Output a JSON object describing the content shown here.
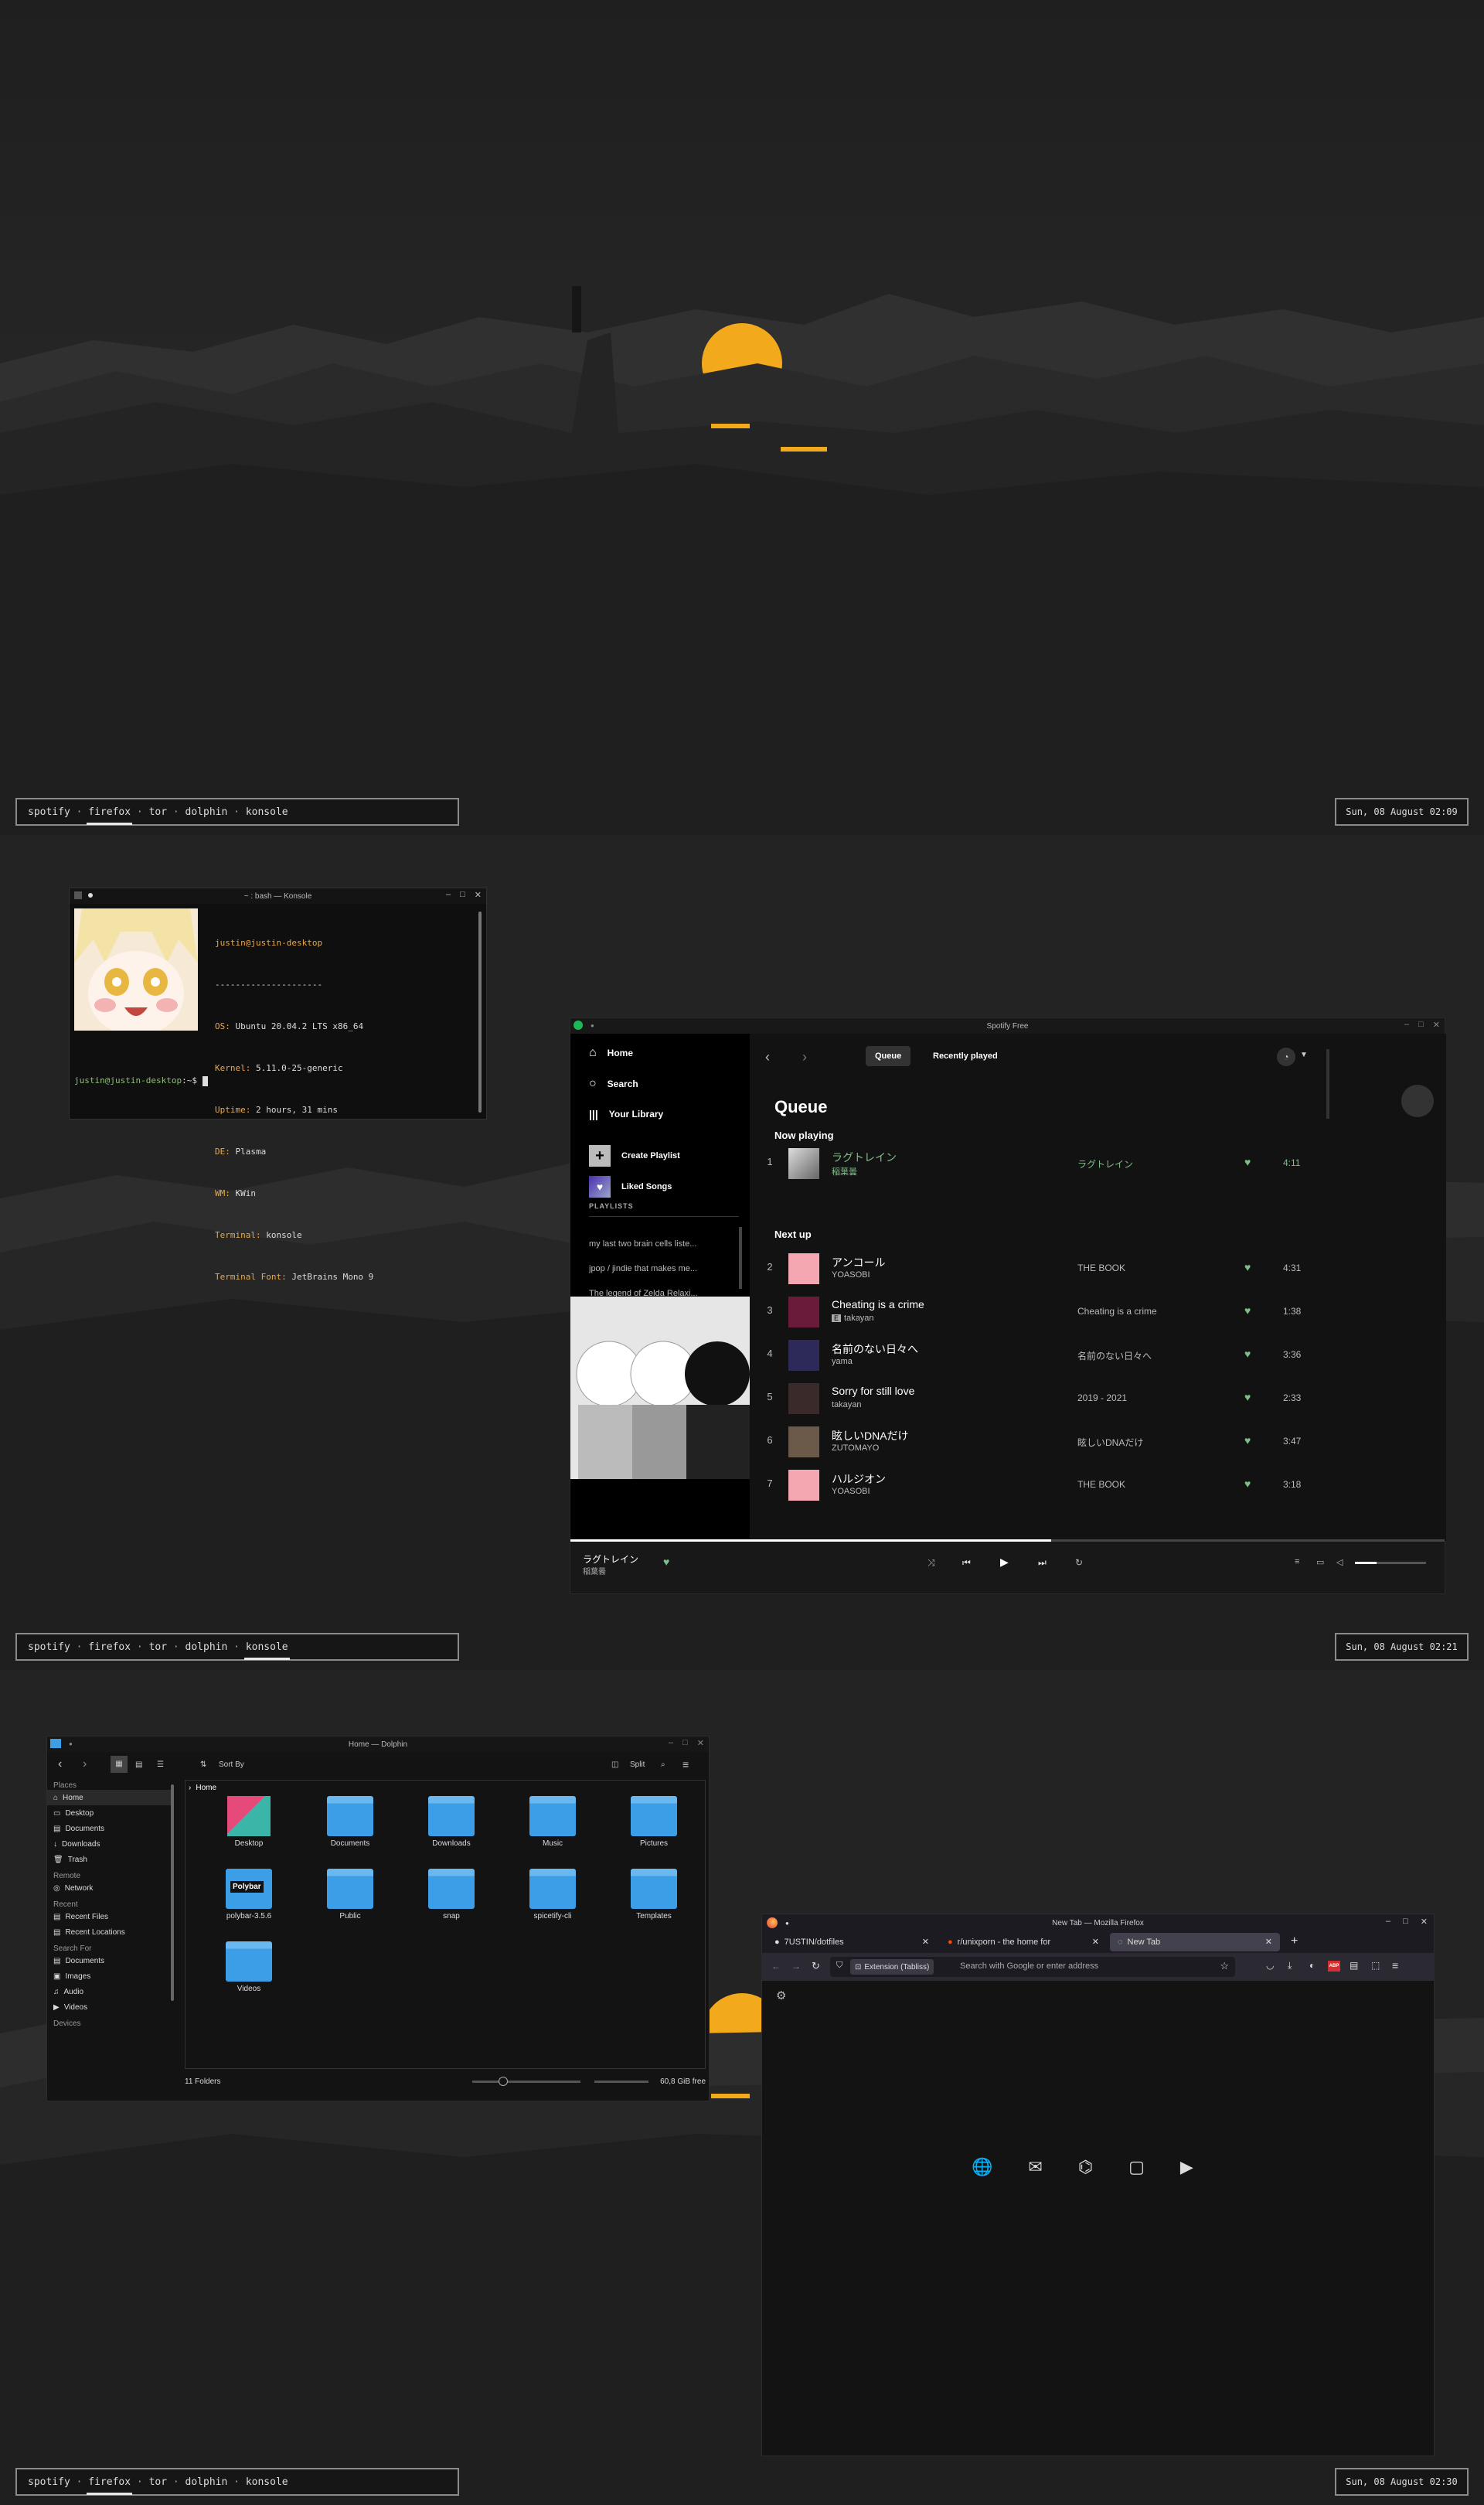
{
  "workspaces": {
    "sep": " · ",
    "items": [
      "spotify",
      "firefox",
      "tor",
      "dolphin",
      "konsole"
    ]
  },
  "screens": [
    {
      "active_workspace": 1,
      "clock": "Sun, 08 August 02:09"
    },
    {
      "active_workspace": 4,
      "clock": "Sun, 08 August 02:21"
    },
    {
      "active_workspace": 1,
      "clock": "Sun, 08 August 02:30"
    }
  ],
  "colors": {
    "accent": "#f2a91c",
    "spotify_green": "#7fbf8a",
    "terminal_key": "#e8a84a"
  },
  "konsole": {
    "title": "~ : bash — Konsole",
    "header": "justin@justin-desktop",
    "divider": "---------------------",
    "info": [
      {
        "key": "OS",
        "value": "Ubuntu 20.04.2 LTS x86_64"
      },
      {
        "key": "Kernel",
        "value": "5.11.0-25-generic"
      },
      {
        "key": "Uptime",
        "value": "2 hours, 31 mins"
      },
      {
        "key": "DE",
        "value": "Plasma"
      },
      {
        "key": "WM",
        "value": "KWin"
      },
      {
        "key": "Terminal",
        "value": "konsole"
      },
      {
        "key": "Terminal Font",
        "value": "JetBrains Mono 9"
      }
    ],
    "prompt_user": "justin@justin-desktop",
    "prompt_rest": ":~$ "
  },
  "spotify": {
    "title": "Spotify Free",
    "tabs": [
      "Queue",
      "Recently played"
    ],
    "nav": [
      "Home",
      "Search",
      "Your Library"
    ],
    "create_playlist": "Create Playlist",
    "liked_songs": "Liked Songs",
    "playlists_heading": "PLAYLISTS",
    "playlists": [
      "my last two brain cells liste...",
      "jpop / jindie that makes me...",
      "The legend of Zelda Relaxi..."
    ],
    "queue_heading": "Queue",
    "now_playing_heading": "Now playing",
    "next_up_heading": "Next up",
    "now_playing": {
      "num": "1",
      "title": "ラグトレイン",
      "artist": "稲葉曇",
      "album": "ラグトレイン",
      "duration": "4:11"
    },
    "next_up": [
      {
        "num": "2",
        "title": "アンコール",
        "artist": "YOASOBI",
        "album": "THE BOOK",
        "duration": "4:31"
      },
      {
        "num": "3",
        "title": "Cheating is a crime",
        "artist": "takayan",
        "explicit": "E",
        "album": "Cheating is a crime",
        "duration": "1:38"
      },
      {
        "num": "4",
        "title": "名前のない日々へ",
        "artist": "yama",
        "album": "名前のない日々へ",
        "duration": "3:36"
      },
      {
        "num": "5",
        "title": "Sorry for still love",
        "artist": "takayan",
        "album": "2019 - 2021",
        "duration": "2:33"
      },
      {
        "num": "6",
        "title": "眩しいDNAだけ",
        "artist": "ZUTOMAYO",
        "album": "眩しいDNAだけ",
        "duration": "3:47"
      },
      {
        "num": "7",
        "title": "ハルジオン",
        "artist": "YOASOBI",
        "album": "THE BOOK",
        "duration": "3:18"
      }
    ],
    "player": {
      "title": "ラグトレイン",
      "artist": "稲葉曇",
      "progress": 0.55,
      "volume": 0.3
    }
  },
  "dolphin": {
    "title": "Home — Dolphin",
    "sort_label": "Sort By",
    "split_label": "Split",
    "breadcrumb": "Home",
    "sidebar": [
      {
        "heading": "Places",
        "items": [
          "Home",
          "Desktop",
          "Documents",
          "Downloads",
          "Trash"
        ]
      },
      {
        "heading": "Remote",
        "items": [
          "Network"
        ]
      },
      {
        "heading": "Recent",
        "items": [
          "Recent Files",
          "Recent Locations"
        ]
      },
      {
        "heading": "Search For",
        "items": [
          "Documents",
          "Images",
          "Audio",
          "Videos"
        ]
      },
      {
        "heading": "Devices",
        "items": []
      }
    ],
    "files": [
      "Desktop",
      "Documents",
      "Downloads",
      "Music",
      "Pictures",
      "polybar-3.5.6",
      "Public",
      "snap",
      "spicetify-cli",
      "Templates",
      "Videos"
    ],
    "polybar_label": "Polybar",
    "status_left": "11 Folders",
    "status_right": "60,8 GiB free"
  },
  "firefox": {
    "title": "New Tab — Mozilla Firefox",
    "tabs": [
      "7USTIN/dotfiles",
      "r/unixporn - the home for",
      "New Tab"
    ],
    "new_tab_button": "+",
    "url_chip": "Extension (Tabliss)",
    "url_placeholder": "Search with Google or enter address",
    "adblock_label": "ABP"
  }
}
